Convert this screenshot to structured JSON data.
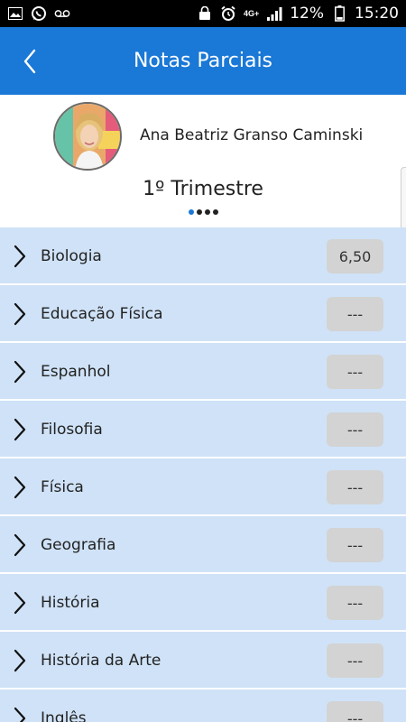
{
  "status_bar": {
    "battery_percent": "12%",
    "time": "15:20",
    "network": "4G+",
    "icons": [
      "gallery-icon",
      "whatsapp-icon",
      "voicemail-icon",
      "lock-icon",
      "alarm-icon",
      "signal-icon",
      "battery-icon"
    ]
  },
  "app_bar": {
    "title": "Notas Parciais",
    "back_icon": "chevron-left-icon"
  },
  "profile": {
    "name": "Ana Beatriz Granso Caminski",
    "term": "1º Trimestre",
    "pager": {
      "count": 4,
      "active_index": 0
    }
  },
  "subjects": [
    {
      "name": "Biologia",
      "grade": "6,50"
    },
    {
      "name": "Educação Física",
      "grade": "---"
    },
    {
      "name": "Espanhol",
      "grade": "---"
    },
    {
      "name": "Filosofia",
      "grade": "---"
    },
    {
      "name": "Física",
      "grade": "---"
    },
    {
      "name": "Geografia",
      "grade": "---"
    },
    {
      "name": "História",
      "grade": "---"
    },
    {
      "name": "História da Arte",
      "grade": "---"
    },
    {
      "name": "Inglês",
      "grade": "---"
    }
  ],
  "colors": {
    "app_bar": "#1a78d6",
    "row_background": "#cfe2f7",
    "grade_badge": "#d3d3d3"
  }
}
